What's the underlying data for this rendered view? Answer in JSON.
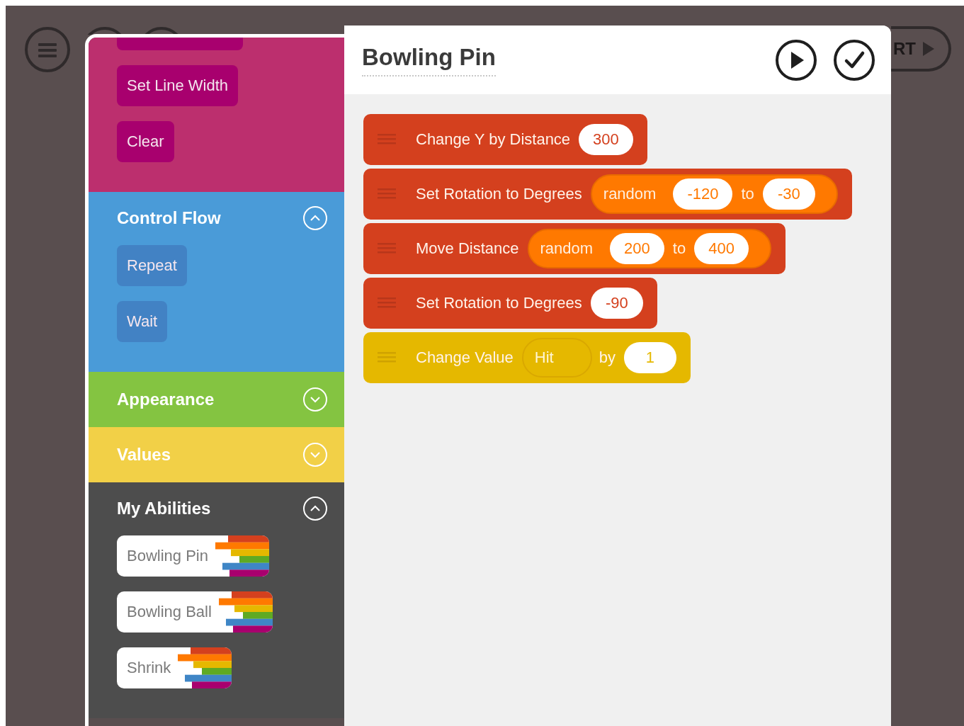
{
  "stage": {
    "start_button": {
      "label": "RT"
    }
  },
  "palette": {
    "sections": [
      {
        "kind": "pen",
        "scrolled": true,
        "blocks": [
          "Set Line Width",
          "Clear"
        ]
      },
      {
        "kind": "control",
        "title": "Control Flow",
        "expanded": true,
        "blocks": [
          "Repeat",
          "Wait"
        ]
      },
      {
        "kind": "appearance",
        "title": "Appearance",
        "expanded": false
      },
      {
        "kind": "values",
        "title": "Values",
        "expanded": false
      },
      {
        "kind": "abilities",
        "title": "My Abilities",
        "expanded": true,
        "blocks": [
          "Bowling Pin",
          "Bowling Ball",
          "Shrink"
        ]
      }
    ]
  },
  "editor": {
    "title": "Bowling Pin",
    "blocks": [
      {
        "kind": "motion",
        "parts": [
          {
            "kind": "text",
            "text": "Change Y by Distance"
          },
          {
            "kind": "number",
            "text": "300"
          }
        ]
      },
      {
        "kind": "motion",
        "parts": [
          {
            "kind": "text",
            "text": "Set Rotation to Degrees"
          },
          {
            "kind": "random",
            "label": "random",
            "from": "-120",
            "to_word": "to",
            "to": "-30"
          }
        ]
      },
      {
        "kind": "motion",
        "parts": [
          {
            "kind": "text",
            "text": "Move Distance"
          },
          {
            "kind": "random",
            "label": "random",
            "from": "200",
            "to_word": "to",
            "to": "400"
          }
        ]
      },
      {
        "kind": "motion",
        "parts": [
          {
            "kind": "text",
            "text": "Set Rotation to Degrees"
          },
          {
            "kind": "number",
            "text": "-90"
          }
        ]
      },
      {
        "kind": "values",
        "parts": [
          {
            "kind": "text",
            "text": "Change Value"
          },
          {
            "kind": "variable",
            "text": "Hit"
          },
          {
            "kind": "text",
            "text": "by"
          },
          {
            "kind": "number",
            "text": "1"
          }
        ]
      }
    ]
  }
}
